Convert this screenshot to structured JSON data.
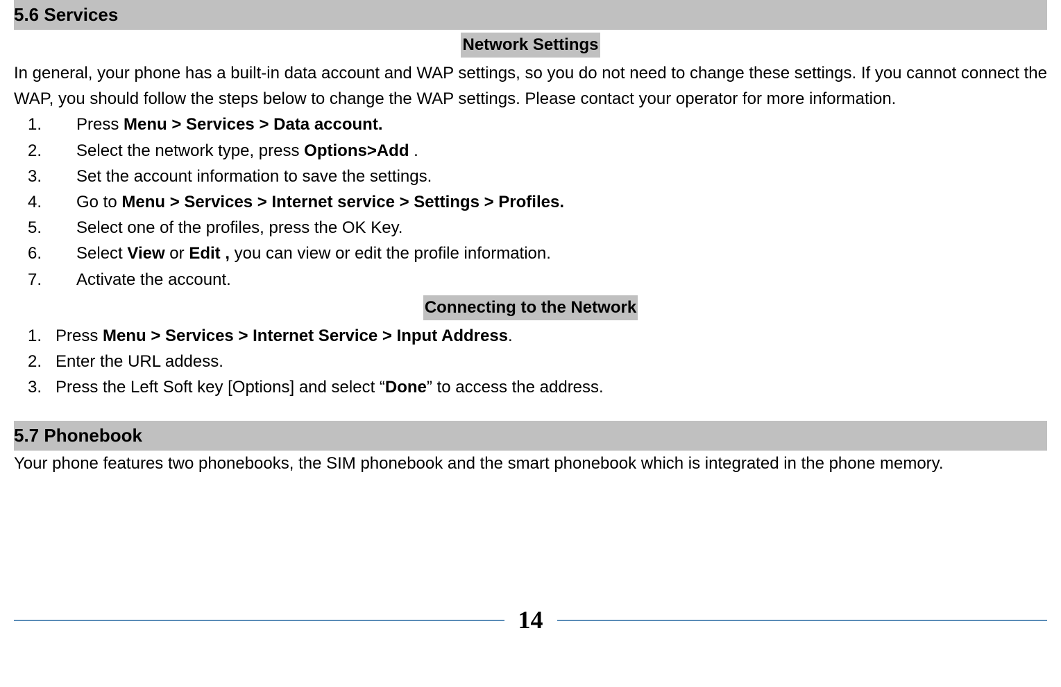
{
  "section_5_6": {
    "title": "5.6 Services",
    "network_settings": {
      "heading": "Network Settings",
      "intro": "In general, your phone has a built-in data account and WAP settings, so you do not need to change these settings. If you cannot connect the WAP, you should follow the steps below to change the WAP settings. Please contact your operator for more information.",
      "steps": [
        {
          "num": "1.",
          "pre": "Press ",
          "bold": "Menu > Services > Data account.",
          "post": ""
        },
        {
          "num": "2.",
          "pre": "Select the network type, press ",
          "bold": "Options>Add",
          "post": " ."
        },
        {
          "num": "3.",
          "pre": "Set the account information to save the settings.",
          "bold": "",
          "post": ""
        },
        {
          "num": "4.",
          "pre": "Go to ",
          "bold": "Menu > Services > Internet service > Settings > Profiles.",
          "post": ""
        },
        {
          "num": "5.",
          "pre": "Select one of the profiles, press the OK Key.",
          "bold": "",
          "post": ""
        },
        {
          "num": "6.",
          "pre": "Select ",
          "bold": "View",
          "mid": " or ",
          "bold2": "Edit ,",
          "post": " you can view or edit the profile information."
        },
        {
          "num": "7.",
          "pre": "Activate the account.",
          "bold": "",
          "post": ""
        }
      ]
    },
    "connecting": {
      "heading": "Connecting to the Network",
      "steps": [
        {
          "num": "1.",
          "pre": "Press ",
          "bold": "Menu > Services > Internet Service > Input Address",
          "post": "."
        },
        {
          "num": "2.",
          "pre": "Enter the URL addess.",
          "bold": "",
          "post": ""
        },
        {
          "num": "3.",
          "pre": "Press the Left Soft key [Options] and select “",
          "bold": "Done",
          "post": "” to access the address."
        }
      ]
    }
  },
  "section_5_7": {
    "title": "5.7 Phonebook",
    "intro": "Your phone features two phonebooks, the SIM phonebook and the smart phonebook which is integrated in the phone memory."
  },
  "page_number": "14"
}
